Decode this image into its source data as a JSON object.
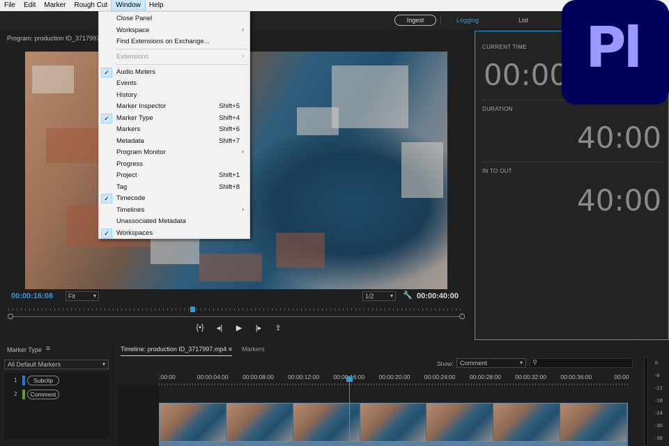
{
  "menubar": {
    "items": [
      "File",
      "Edit",
      "Marker",
      "Rough Cut",
      "Window",
      "Help"
    ],
    "active": "Window"
  },
  "header": {
    "ingest_label": "Ingest",
    "tabs": [
      "Logging",
      "List"
    ],
    "active_tab": "Logging"
  },
  "program_monitor": {
    "title": "Program: production ID_3717997.m",
    "current_timecode": "00:00:16:08",
    "fit": "Fit",
    "resolution": "1/2",
    "duration_timecode": "00:00:40:00",
    "playhead_fraction": 0.4
  },
  "logging_panel": {
    "current_time_label": "CURRENT TIME",
    "current_time_value": "00:00",
    "duration_label": "DURATION",
    "duration_value": "40:00",
    "in_to_out_label": "IN TO OUT",
    "in_to_out_value": "40:00"
  },
  "logo": {
    "text": "Pl",
    "bg": "#00005b",
    "fg": "#9999ff"
  },
  "window_menu": {
    "items": [
      {
        "label": "Close Panel",
        "shortcut": "",
        "checked": false,
        "submenu": false,
        "disabled": false
      },
      {
        "label": "Workspace",
        "shortcut": "",
        "checked": false,
        "submenu": true,
        "disabled": false
      },
      {
        "label": "Find Extensions on Exchange...",
        "shortcut": "",
        "checked": false,
        "submenu": false,
        "disabled": false
      },
      {
        "label": "Extensions",
        "shortcut": "",
        "checked": false,
        "submenu": true,
        "disabled": true
      },
      {
        "label": "Audio Meters",
        "shortcut": "",
        "checked": true,
        "submenu": false,
        "disabled": false
      },
      {
        "label": "Events",
        "shortcut": "",
        "checked": false,
        "submenu": false,
        "disabled": false
      },
      {
        "label": "History",
        "shortcut": "",
        "checked": false,
        "submenu": false,
        "disabled": false
      },
      {
        "label": "Marker Inspector",
        "shortcut": "Shift+5",
        "checked": false,
        "submenu": false,
        "disabled": false
      },
      {
        "label": "Marker Type",
        "shortcut": "Shift+4",
        "checked": true,
        "submenu": false,
        "disabled": false
      },
      {
        "label": "Markers",
        "shortcut": "Shift+6",
        "checked": false,
        "submenu": false,
        "disabled": false
      },
      {
        "label": "Metadata",
        "shortcut": "Shift+7",
        "checked": false,
        "submenu": false,
        "disabled": false
      },
      {
        "label": "Program Monitor",
        "shortcut": "",
        "checked": false,
        "submenu": true,
        "disabled": false
      },
      {
        "label": "Progress",
        "shortcut": "",
        "checked": false,
        "submenu": false,
        "disabled": false
      },
      {
        "label": "Project",
        "shortcut": "Shift+1",
        "checked": false,
        "submenu": false,
        "disabled": false
      },
      {
        "label": "Tag",
        "shortcut": "Shift+8",
        "checked": false,
        "submenu": false,
        "disabled": false
      },
      {
        "label": "Timecode",
        "shortcut": "",
        "checked": true,
        "submenu": false,
        "disabled": false
      },
      {
        "label": "Timelines",
        "shortcut": "",
        "checked": false,
        "submenu": true,
        "disabled": false
      },
      {
        "label": "Unassociated Metadata",
        "shortcut": "",
        "checked": false,
        "submenu": false,
        "disabled": false
      },
      {
        "label": "Workspaces",
        "shortcut": "",
        "checked": true,
        "submenu": false,
        "disabled": false
      }
    ]
  },
  "marker_type_panel": {
    "title": "Marker Type",
    "filter": "All Default Markers",
    "rows": [
      {
        "num": "1",
        "label": "Subclip",
        "color": "#1e7ad8"
      },
      {
        "num": "2",
        "label": "Comment",
        "color": "#5d9a3a"
      }
    ]
  },
  "timeline": {
    "tab_label": "Timeline: production ID_3717997.mp4",
    "markers_tab": "Markers",
    "show_label": "Show:",
    "show_value": "Comment",
    "ticks": [
      ":00:00",
      "00:00:04:00",
      "00:00:08:00",
      "00:00:12:00",
      "00:00:16:00",
      "00:00:20:00",
      "00:00:24:00",
      "00:00:28:00",
      "00:00:32:00",
      "00:00:36:00",
      "00:00"
    ],
    "thumb_count": 7
  },
  "audio_meter": {
    "scale": [
      "0",
      "-6",
      "-12",
      "-18",
      "-24",
      "-30",
      "-36"
    ]
  }
}
